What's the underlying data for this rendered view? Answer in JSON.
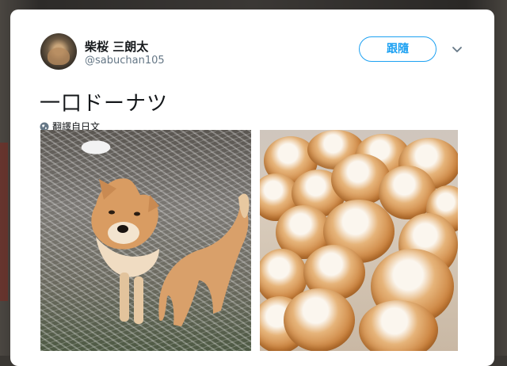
{
  "user": {
    "display_name": "柴桜 三朗太",
    "handle": "@sabuchan105",
    "avatar_icon": "avatar-photo-icon"
  },
  "actions": {
    "follow_label": "跟隨",
    "more_icon": "chevron-down-icon"
  },
  "tweet": {
    "text": "一口ドーナツ",
    "translate_label": "翻譯自日文",
    "translate_icon": "globe-icon"
  },
  "media": [
    {
      "kind": "photo",
      "subject": "shiba-inu-dog-with-frost"
    },
    {
      "kind": "photo",
      "subject": "sugar-donuts"
    }
  ],
  "colors": {
    "accent": "#1da1f2",
    "text": "#14171a",
    "secondary_text": "#657786",
    "card": "#ffffff"
  }
}
